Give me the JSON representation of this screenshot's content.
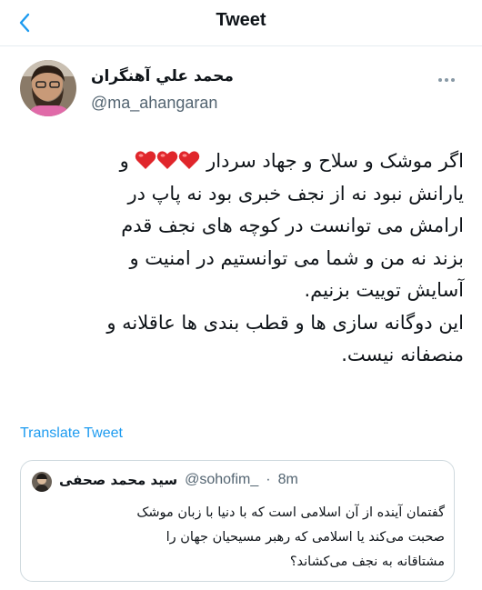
{
  "header": {
    "title": "Tweet",
    "back_icon": "chevron-left-icon",
    "accent": "#1d9bf0"
  },
  "tweet": {
    "author_name": "محمد علي آهنگران",
    "author_handle": "@ma_ahangaran",
    "more_icon": "more-horizontal-icon",
    "lines": {
      "l1_before": "اگر موشک و سلاح و جهاد سردار",
      "l1_after": "و",
      "l2": "یارانش نبود نه از نجف خبری بود نه پاپ در",
      "l3": "ارامش می توانست در کوچه های نجف قدم",
      "l4": "بزند نه من و شما می توانستیم در امنیت و",
      "l5": "آسایش توییت بزنیم.",
      "l6": "این دوگانه سازی ها و قطب بندی ها عاقلانه و",
      "l7": "منصفانه نیست."
    },
    "emoji": "heart-icon",
    "emoji_count": 3,
    "heart_color": "#e0262b",
    "translate_label": "Translate Tweet"
  },
  "quoted": {
    "author_name": "سید محمد صحفی",
    "author_handle": "@sohofim_",
    "separator": "·",
    "time": "8m",
    "lines": {
      "l1": "گفتمان آینده از آن اسلامی است که با دنیا با زبان موشک",
      "l2": "صحبت می‌کند یا اسلامی که رهبر مسیحیان جهان را",
      "l3": "مشتاقانه به نجف می‌کشاند؟"
    }
  }
}
